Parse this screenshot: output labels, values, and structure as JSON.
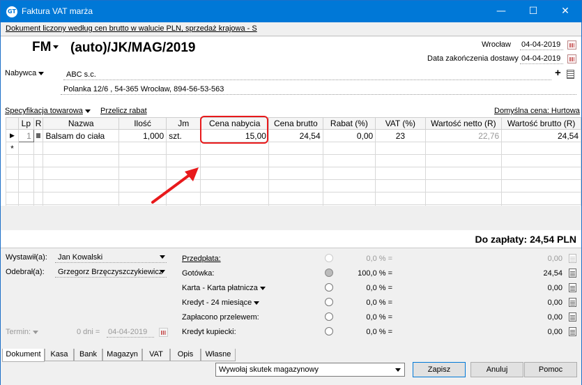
{
  "window": {
    "title": "Faktura VAT marża",
    "minimize": "—",
    "maximize": "☐",
    "close": "✕"
  },
  "info_line": "Dokument liczony według cen brutto w walucie PLN, sprzedaż krajowa - S",
  "doc": {
    "type": "FM",
    "number": "(auto)/JK/MAG/2019",
    "place": "Wrocław",
    "issue_date": "04-04-2019",
    "delivery_label": "Data zakończenia dostawy",
    "delivery_date": "04-04-2019"
  },
  "buyer": {
    "label": "Nabywca",
    "name": "ABC s.c.",
    "address": "Polanka  12/6 , 54-365 Wrocław, 894-56-53-563",
    "add_icon": "+"
  },
  "spec": {
    "label": "Specyfikacja towarowa",
    "recalc": "Przelicz rabat",
    "default_price": "Domyślna cena: Hurtowa"
  },
  "table": {
    "headers": [
      "Lp",
      "R",
      "Nazwa",
      "Ilość",
      "Jm",
      "Cena nabycia",
      "Cena brutto",
      "Rabat (%)",
      "VAT (%)",
      "Wartość netto (R)",
      "Wartość brutto (R)"
    ],
    "rows": [
      {
        "lp": "1",
        "name": "Balsam do ciała",
        "qty": "1,000",
        "unit": "szt.",
        "purchase": "15,00",
        "gross": "24,54",
        "discount": "0,00",
        "vat": "23",
        "net_value": "22,76",
        "gross_value": "24,54"
      }
    ],
    "new_row_marker": "*"
  },
  "total": "Do zapłaty: 24,54 PLN",
  "issued_by": {
    "label": "Wystawił(a):",
    "value": "Jan Kowalski"
  },
  "received_by": {
    "label": "Odebrał(a):",
    "value": "Grzegorz Brzęczyszczykiewicz"
  },
  "term": {
    "label": "Termin:",
    "days": "0 dni =",
    "date": "04-04-2019"
  },
  "payments": [
    {
      "label": "Przedpłata:",
      "pct": "0,0 % =",
      "amount": "0,00"
    },
    {
      "label": "Gotówka:",
      "pct": "100,0 % =",
      "amount": "24,54"
    },
    {
      "label": "Karta - Karta płatnicza",
      "pct": "0,0 % =",
      "amount": "0,00"
    },
    {
      "label": "Kredyt - 24 miesiące",
      "pct": "0,0 % =",
      "amount": "0,00"
    },
    {
      "label": "Zapłacono przelewem:",
      "pct": "0,0 % =",
      "amount": "0,00"
    },
    {
      "label": "Kredyt kupiecki:",
      "pct": "0,0 % =",
      "amount": "0,00"
    }
  ],
  "tabs": [
    "Dokument",
    "Kasa",
    "Bank",
    "Magazyn",
    "VAT",
    "Opis",
    "Własne"
  ],
  "warehouse_action": "Wywołaj skutek magazynowy",
  "buttons": {
    "save": "Zapisz",
    "cancel": "Anuluj",
    "help": "Pomoc"
  },
  "colors": {
    "titlebar": "#0078d7",
    "highlight": "#e8191b"
  }
}
